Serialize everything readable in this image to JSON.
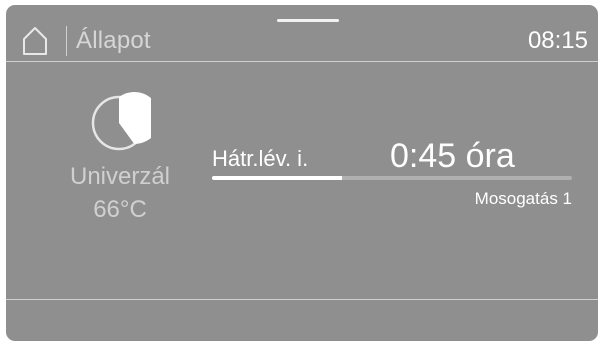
{
  "header": {
    "title": "Állapot",
    "time": "08:15"
  },
  "program": {
    "icon": "partial-circle-progress-icon",
    "name": "Univerzál",
    "temperature": "66°C"
  },
  "status": {
    "remaining_label": "Hátr.lév. i.",
    "remaining_value": "0:45 óra",
    "progress": 0.36,
    "phase": "Mosogatás 1"
  },
  "colors": {
    "screen_bg": "#8f8f8f",
    "text_primary": "#ffffff",
    "text_secondary": "#d0d0d0",
    "progress_track": "#b0b0b0",
    "progress_fill": "#ffffff"
  }
}
